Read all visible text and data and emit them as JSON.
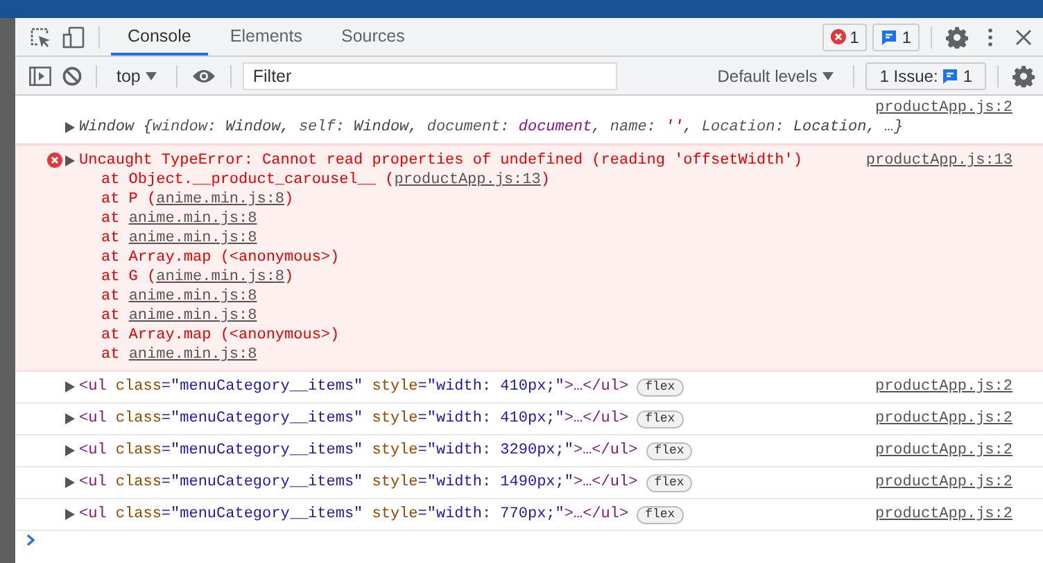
{
  "tabs": [
    {
      "label": "Console",
      "selected": true
    },
    {
      "label": "Elements",
      "selected": false
    },
    {
      "label": "Sources",
      "selected": false
    }
  ],
  "error_count": "1",
  "message_count": "1",
  "context": "top",
  "filter": {
    "placeholder": "Filter"
  },
  "levels": "Default levels",
  "issues": {
    "label": "1 Issue:",
    "count": "1"
  },
  "messages": [
    {
      "kind": "object",
      "expanded": false,
      "source": "productApp.js:2",
      "tokens": [
        {
          "text": "Window {",
          "kind": "text"
        },
        {
          "text": "window",
          "kind": "key"
        },
        {
          "text": ": Window, ",
          "kind": "text"
        },
        {
          "text": "self",
          "kind": "key"
        },
        {
          "text": ": Window, ",
          "kind": "text"
        },
        {
          "text": "document",
          "kind": "key"
        },
        {
          "text": ": ",
          "kind": "text"
        },
        {
          "text": "document",
          "kind": "ref"
        },
        {
          "text": ", ",
          "kind": "text"
        },
        {
          "text": "name",
          "kind": "key"
        },
        {
          "text": ": ",
          "kind": "text"
        },
        {
          "text": "''",
          "kind": "str"
        },
        {
          "text": ", ",
          "kind": "text"
        },
        {
          "text": "Location",
          "kind": "key"
        },
        {
          "text": ": Location, …}",
          "kind": "text"
        }
      ]
    },
    {
      "kind": "error",
      "expanded": false,
      "source": "productApp.js:13",
      "text": "Uncaught TypeError: Cannot read properties of undefined (reading 'offsetWidth')",
      "stack": [
        {
          "before": "at Object.__product_carousel__ (",
          "link": "productApp.js:13",
          "after": ")"
        },
        {
          "before": "at P (",
          "link": "anime.min.js:8",
          "after": ")"
        },
        {
          "before": "at ",
          "link": "anime.min.js:8"
        },
        {
          "before": "at ",
          "link": "anime.min.js:8"
        },
        {
          "before": "at Array.map (<anonymous>)"
        },
        {
          "before": "at G (",
          "link": "anime.min.js:8",
          "after": ")"
        },
        {
          "before": "at ",
          "link": "anime.min.js:8"
        },
        {
          "before": "at ",
          "link": "anime.min.js:8"
        },
        {
          "before": "at Array.map (<anonymous>)"
        },
        {
          "before": "at ",
          "link": "anime.min.js:8"
        }
      ]
    },
    {
      "kind": "element",
      "expanded": false,
      "source": "productApp.js:2",
      "badge": "flex",
      "tokens": [
        {
          "text": "<ul",
          "kind": "tag"
        },
        {
          "text": " class",
          "kind": "attr"
        },
        {
          "text": "=\"menuCategory__items\"",
          "kind": "val"
        },
        {
          "text": " style",
          "kind": "attr"
        },
        {
          "text": "=\"width: 410px;\"",
          "kind": "val"
        },
        {
          "text": ">…</ul>",
          "kind": "tag"
        }
      ]
    },
    {
      "kind": "element",
      "expanded": false,
      "source": "productApp.js:2",
      "badge": "flex",
      "tokens": [
        {
          "text": "<ul",
          "kind": "tag"
        },
        {
          "text": " class",
          "kind": "attr"
        },
        {
          "text": "=\"menuCategory__items\"",
          "kind": "val"
        },
        {
          "text": " style",
          "kind": "attr"
        },
        {
          "text": "=\"width: 410px;\"",
          "kind": "val"
        },
        {
          "text": ">…</ul>",
          "kind": "tag"
        }
      ]
    },
    {
      "kind": "element",
      "expanded": false,
      "source": "productApp.js:2",
      "badge": "flex",
      "tokens": [
        {
          "text": "<ul",
          "kind": "tag"
        },
        {
          "text": " class",
          "kind": "attr"
        },
        {
          "text": "=\"menuCategory__items\"",
          "kind": "val"
        },
        {
          "text": " style",
          "kind": "attr"
        },
        {
          "text": "=\"width: 3290px;\"",
          "kind": "val"
        },
        {
          "text": ">…</ul>",
          "kind": "tag"
        }
      ]
    },
    {
      "kind": "element",
      "expanded": false,
      "source": "productApp.js:2",
      "badge": "flex",
      "tokens": [
        {
          "text": "<ul",
          "kind": "tag"
        },
        {
          "text": " class",
          "kind": "attr"
        },
        {
          "text": "=\"menuCategory__items\"",
          "kind": "val"
        },
        {
          "text": " style",
          "kind": "attr"
        },
        {
          "text": "=\"width: 1490px;\"",
          "kind": "val"
        },
        {
          "text": ">…</ul>",
          "kind": "tag"
        }
      ]
    },
    {
      "kind": "element",
      "expanded": false,
      "source": "productApp.js:2",
      "badge": "flex",
      "tokens": [
        {
          "text": "<ul",
          "kind": "tag"
        },
        {
          "text": " class",
          "kind": "attr"
        },
        {
          "text": "=\"menuCategory__items\"",
          "kind": "val"
        },
        {
          "text": " style",
          "kind": "attr"
        },
        {
          "text": "=\"width: 770px;\"",
          "kind": "val"
        },
        {
          "text": ">…</ul>",
          "kind": "tag"
        }
      ]
    }
  ]
}
